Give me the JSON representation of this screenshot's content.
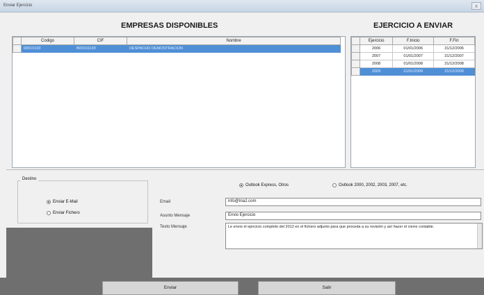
{
  "window": {
    "title": "Enviar Ejercicio",
    "close_glyph": "x"
  },
  "empresas": {
    "heading": "EMPRESAS DISPONIBLES",
    "columns": [
      "Codigo",
      "CIF",
      "Nombre"
    ],
    "rows": [
      {
        "codigo": "00010103",
        "cif": "B00101103",
        "nombre": "DESPACHO DEMOSTRACION"
      }
    ]
  },
  "ejercicios": {
    "heading": "EJERCICIO A ENVIAR",
    "columns": [
      "Ejercicio",
      "F.Inicio",
      "F.Fin"
    ],
    "rows": [
      {
        "ejercicio": "2006",
        "inicio": "01/01/2006",
        "fin": "31/12/2006"
      },
      {
        "ejercicio": "2007",
        "inicio": "01/01/2007",
        "fin": "31/12/2007"
      },
      {
        "ejercicio": "2008",
        "inicio": "01/01/2008",
        "fin": "31/12/2008"
      },
      {
        "ejercicio": "2009",
        "inicio": "01/01/2009",
        "fin": "31/12/2009"
      }
    ],
    "selected_index": 3
  },
  "destino": {
    "legend": "Destino",
    "options": [
      "Enviar E-Mail",
      "Enviar Fichero"
    ],
    "selected": "Enviar E-Mail"
  },
  "cliente": {
    "options": [
      "Outlook Express, Otros",
      "Outlook 2000, 2002, 2003, 2007, etc."
    ],
    "selected": "Outlook Express, Otros"
  },
  "form": {
    "email_label": "Email",
    "email_value": "info@tria2.com",
    "asunto_label": "Asunto Mensaje",
    "asunto_value": "Envio Ejercicio",
    "texto_label": "Texto Mensaje",
    "texto_value": "Le envio el ejercicio completo del 2012 en el fichero adjunto para que proceda a su revisión y así hacer el cierre contable."
  },
  "buttons": {
    "enviar": "Enviar",
    "salir": "Salir"
  }
}
